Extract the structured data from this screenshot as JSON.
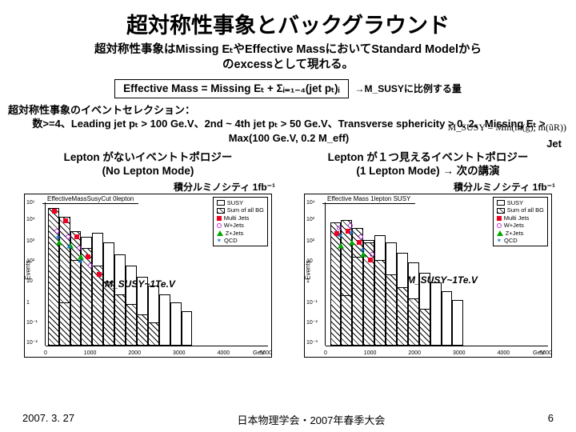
{
  "title": "超対称性事象とバックグラウンド",
  "subtitle_l1": "超対称性事象はMissing EₜやEffective MassにおいてStandard Modelから",
  "subtitle_l2": "のexcessとして現れる。",
  "formula": "Effective Mass = Missing Eₜ + Σᵢ₌₁₋₄(jet pₜ)ᵢ",
  "formula_note": "→M_SUSYに比例する量",
  "msusy_eq": "M_SUSY = Min(m(g̃), m(ũR))",
  "selection_head": "超対称性事象のイベントセレクション：",
  "jet_label": "Jet",
  "selection_body": "数>=4、Leading jet pₜ > 100 Ge.V、2nd ~ 4th jet pₜ > 50 Ge.V、Transverse sphericity > 0. 2、Missing Eₜ > Max(100 Ge.V, 0.2 M_eff)",
  "left": {
    "head1": "Lepton がないイベントトポロジー",
    "head2": "(No Lepton Mode)",
    "lumi": "積分ルミノシティ 1fb⁻¹",
    "annot": "M_SUSY~1Te.V",
    "chart_title": "EffectiveMassSusyCut 0lepton",
    "ylabel": "Events",
    "xunit": "GeV",
    "legend": [
      "SUSY",
      "Sum of all BG",
      "Multi Jets",
      "W+Jets",
      "Z+Jets",
      "QCD"
    ]
  },
  "right": {
    "head1": "Lepton が１つ見えるイベントトポロジー",
    "head2": "(1 Lepton Mode) → 次の講演",
    "lumi": "積分ルミノシティ 1fb⁻¹",
    "annot": "M_SUSY~1Te.V",
    "chart_title": "Effective Mass 1lepton SUSY",
    "ylabel": "Events",
    "xunit": "GeV",
    "legend": [
      "SUSY",
      "Sum of all BG",
      "Multi Jets",
      "W+Jets",
      "Z+Jets",
      "QCD"
    ]
  },
  "footer": {
    "date": "2007. 3. 27",
    "venue": "日本物理学会・2007年春季大会",
    "page": "6"
  },
  "chart_data": [
    {
      "type": "bar",
      "title": "EffectiveMassSusyCut 0lepton (No Lepton Mode)",
      "xlabel": "Effective Mass (GeV)",
      "ylabel": "Events",
      "xlim": [
        0,
        5000
      ],
      "ylim": [
        0.01,
        100000
      ],
      "yscale": "log",
      "x_bin_centers": [
        250,
        500,
        750,
        1000,
        1250,
        1500,
        1750,
        2000,
        2250,
        2500,
        2750,
        3000,
        3500
      ],
      "series": [
        {
          "name": "SUSY",
          "style": "open histogram",
          "values": [
            2,
            200,
            2000,
            3000,
            1500,
            600,
            250,
            100,
            40,
            15,
            6,
            2,
            0.5
          ]
        },
        {
          "name": "Sum of all BG",
          "style": "hatched histogram",
          "values": [
            50000,
            20000,
            5000,
            700,
            100,
            20,
            5,
            1.5,
            0.6,
            0.2,
            0.08,
            0.03,
            0.02
          ]
        },
        {
          "name": "Multijets",
          "style": "red squares",
          "values": [
            40000,
            15000,
            3000,
            400,
            50,
            8,
            2,
            0.5,
            0.15,
            0.05,
            null,
            null,
            null
          ]
        },
        {
          "name": "W+Jets",
          "style": "purple circles",
          "values": [
            5000,
            3000,
            1000,
            200,
            40,
            8,
            2,
            0.6,
            0.2,
            0.07,
            null,
            null,
            null
          ]
        },
        {
          "name": "Z+Jets",
          "style": "green triangles",
          "values": [
            2000,
            1500,
            600,
            120,
            25,
            6,
            1.5,
            0.5,
            0.15,
            0.05,
            null,
            null,
            null
          ]
        },
        {
          "name": "QCD",
          "style": "blue stars",
          "values": [
            3000,
            1000,
            300,
            60,
            10,
            2,
            0.5,
            0.15,
            null,
            null,
            null,
            null,
            null
          ]
        }
      ],
      "annotation": "M_SUSY ~ 1 TeV",
      "luminosity_fb": 1
    },
    {
      "type": "bar",
      "title": "Effective Mass 1lepton SUSY (1 Lepton Mode)",
      "xlabel": "Effective Mass (GeV)",
      "ylabel": "Events",
      "xlim": [
        0,
        5000
      ],
      "ylim": [
        0.001,
        10000
      ],
      "yscale": "log",
      "x_bin_centers": [
        250,
        500,
        750,
        1000,
        1250,
        1500,
        1750,
        2000,
        2250,
        2500,
        2750,
        3000,
        3500
      ],
      "series": [
        {
          "name": "SUSY",
          "style": "open histogram",
          "values": [
            1,
            40,
            400,
            700,
            450,
            220,
            100,
            45,
            18,
            8,
            3,
            1.2,
            0.3
          ]
        },
        {
          "name": "Sum of all BG",
          "style": "hatched histogram",
          "values": [
            3000,
            4000,
            1500,
            350,
            80,
            18,
            5,
            1.2,
            0.4,
            0.12,
            0.04,
            0.015,
            0.01
          ]
        },
        {
          "name": "Multijets",
          "style": "red squares",
          "values": [
            500,
            700,
            300,
            70,
            15,
            3,
            0.8,
            0.2,
            0.06,
            null,
            null,
            null,
            null
          ]
        },
        {
          "name": "W+Jets",
          "style": "purple circles",
          "values": [
            1500,
            2000,
            800,
            180,
            40,
            10,
            2.5,
            0.7,
            0.2,
            0.06,
            null,
            null,
            null
          ]
        },
        {
          "name": "Z+Jets",
          "style": "green triangles",
          "values": [
            300,
            400,
            180,
            50,
            12,
            3,
            0.8,
            0.25,
            0.08,
            null,
            null,
            null,
            null
          ]
        },
        {
          "name": "QCD",
          "style": "blue stars",
          "values": [
            700,
            900,
            220,
            50,
            13,
            2,
            0.6,
            0.15,
            null,
            null,
            null,
            null,
            null
          ]
        }
      ],
      "annotation": "M_SUSY ~ 1 TeV",
      "luminosity_fb": 1
    }
  ]
}
